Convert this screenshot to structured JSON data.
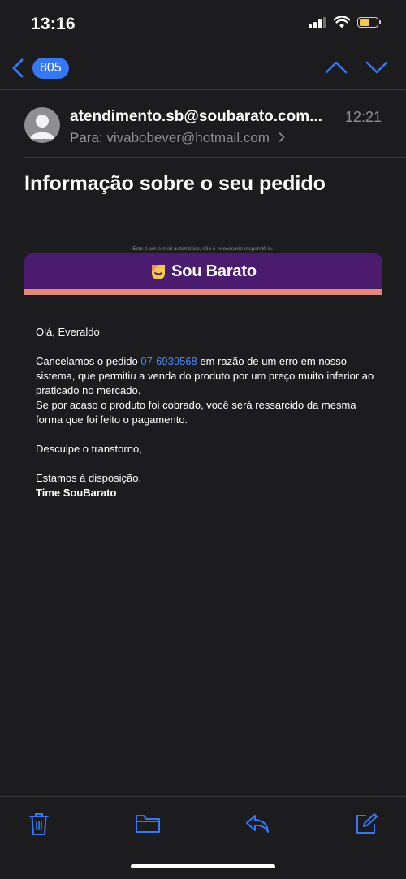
{
  "status": {
    "time": "13:16"
  },
  "nav": {
    "back_count": "805"
  },
  "email": {
    "sender": "atendimento.sb@soubarato.com...",
    "time": "12:21",
    "to_label": "Para:",
    "recipient": "vivabobever@hotmail.com",
    "subject": "Informação sobre o seu pedido",
    "auto_note": "Este é um e-mail automático, não é necessário respondê-lo.",
    "brand_name": "Sou Barato",
    "greeting": "Olá, Everaldo",
    "para1_before": "Cancelamos o pedido ",
    "order_number": "07-6939568",
    "para1_after": " em razão de um erro em nosso sistema, que permitiu a venda do produto por um preço muito inferior ao praticado no mercado.",
    "para2": "Se por acaso o produto foi cobrado, você será ressarcido da mesma forma que foi feito o pagamento.",
    "apology": "Desculpe o transtorno,",
    "closing": "Estamos à disposição,",
    "signature": "Time SouBarato"
  },
  "colors": {
    "accent": "#3478f6",
    "banner": "#4a1b6e",
    "banner_stripe": "#e38a7a",
    "link": "#4a8cf7"
  },
  "icons": {
    "toolbar": [
      "trash-icon",
      "folder-icon",
      "reply-icon",
      "compose-icon"
    ]
  }
}
